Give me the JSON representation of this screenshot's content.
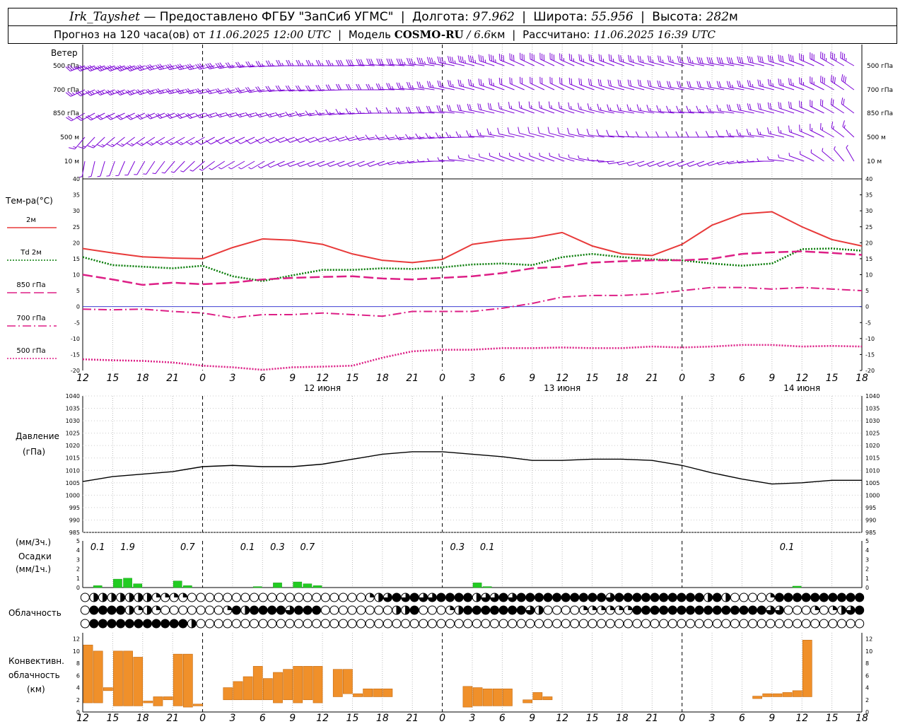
{
  "header": {
    "station": "Irk_Tayshet",
    "dash": "—",
    "provider": "Предоставлено ФГБУ \"ЗапСиб УГМС\"",
    "lon_label": "Долгота:",
    "lon_value": "97.962",
    "lat_label": "Широта:",
    "lat_value": "55.956",
    "alt_label": "Высота:",
    "alt_value": "282",
    "alt_unit": "м",
    "forecast_prefix": "Прогноз на 120 часа(ов) от",
    "forecast_time": "11.06.2025 12:00 UTC",
    "model_label": "Модель",
    "model_name": "COSMO-RU",
    "model_res": "/ 6.6",
    "model_res_unit": "км",
    "computed_label": "Рассчитано:",
    "computed_time": "11.06.2025 16:39 UTC"
  },
  "labels": {
    "wind": "Ветер",
    "wind_levels": [
      "500 гПа",
      "700 гПа",
      "850 гПа",
      "500 м",
      "10  м"
    ],
    "temp_title": "Тем-ра(°С)",
    "pressure_title_1": "Давление",
    "pressure_title_2": "(гПа)",
    "precip_title_1": "(мм/3ч.)",
    "precip_title_2": "Осадки",
    "precip_title_3": "(мм/1ч.)",
    "cloud_title": "Облачность",
    "conv_title_1": "Конвективн.",
    "conv_title_2": "облачность",
    "conv_title_3": "(км)"
  },
  "colors": {
    "wind": "#7a00d6",
    "t2m": "#e83a3a",
    "td2m": "#0a7d0a",
    "t850": "#dd1f86",
    "t700": "#dd1f86",
    "t500": "#dd1f86",
    "pressure": "#000000",
    "precip": "#22cc22",
    "conv": "#f0902a",
    "zero_line": "#2222cc"
  },
  "x_axis": {
    "tick_labels": [
      "12",
      "15",
      "18",
      "21",
      "0",
      "3",
      "6",
      "9",
      "12",
      "15",
      "18",
      "21",
      "0",
      "3",
      "6",
      "9",
      "12",
      "15",
      "18",
      "21",
      "0",
      "3",
      "6",
      "9",
      "12",
      "15",
      "18"
    ],
    "day_labels": [
      {
        "index": 8,
        "text": "12 июня"
      },
      {
        "index": 16,
        "text": "13 июня"
      },
      {
        "index": 24,
        "text": "14 июня"
      }
    ]
  },
  "chart_data": [
    {
      "type": "line",
      "name": "temperature",
      "x_hours": [
        0,
        3,
        6,
        9,
        12,
        15,
        18,
        21,
        24,
        27,
        30,
        33,
        36,
        39,
        42,
        45,
        48,
        51,
        54,
        57,
        60,
        63,
        66,
        69,
        72,
        75,
        78
      ],
      "ylim": [
        -20,
        40
      ],
      "yticks": [
        -20,
        -15,
        -10,
        -5,
        0,
        5,
        10,
        15,
        20,
        25,
        30,
        35,
        40
      ],
      "series": [
        {
          "name": "2м",
          "key": "t2m",
          "style": "solid",
          "values": [
            18.2,
            16.8,
            15.6,
            15.2,
            15.0,
            18.5,
            21.2,
            20.8,
            19.5,
            16.5,
            14.5,
            13.8,
            14.8,
            19.5,
            20.8,
            21.5,
            23.2,
            19.0,
            16.5,
            16.0,
            19.5,
            25.5,
            29.0,
            29.7,
            25.0,
            21.0,
            19.0
          ]
        },
        {
          "name": "Td  2м",
          "key": "td2m",
          "style": "dotted",
          "values": [
            15.5,
            13.0,
            12.5,
            12.0,
            12.8,
            9.5,
            8.0,
            9.8,
            11.5,
            11.5,
            12.0,
            11.8,
            12.3,
            13.2,
            13.5,
            13.0,
            15.5,
            16.5,
            15.5,
            14.8,
            14.5,
            13.5,
            12.8,
            13.5,
            18.0,
            18.2,
            17.5
          ]
        },
        {
          "name": "850 гПа",
          "key": "t850",
          "style": "dash",
          "values": [
            10.0,
            8.5,
            6.8,
            7.5,
            7.0,
            7.5,
            8.5,
            9.0,
            9.3,
            9.5,
            8.8,
            8.5,
            9.0,
            9.5,
            10.5,
            12.0,
            12.5,
            13.8,
            14.2,
            14.5,
            14.5,
            15.0,
            16.5,
            17.0,
            17.3,
            16.8,
            16.2
          ]
        },
        {
          "name": "700 гПа",
          "key": "t700",
          "style": "dashdot",
          "values": [
            -0.8,
            -1.0,
            -0.8,
            -1.5,
            -2.0,
            -3.5,
            -2.5,
            -2.5,
            -2.0,
            -2.5,
            -3.0,
            -1.5,
            -1.5,
            -1.5,
            -0.5,
            1.0,
            3.0,
            3.5,
            3.5,
            4.0,
            5.0,
            6.0,
            6.0,
            5.5,
            6.0,
            5.5,
            5.0
          ]
        },
        {
          "name": "500 гПа",
          "key": "t500",
          "style": "dotted",
          "values": [
            -16.5,
            -16.8,
            -17.0,
            -17.5,
            -18.5,
            -19.0,
            -19.8,
            -19.0,
            -18.8,
            -18.5,
            -16.0,
            -14.0,
            -13.5,
            -13.5,
            -13.0,
            -13.0,
            -12.8,
            -13.0,
            -13.0,
            -12.5,
            -12.8,
            -12.5,
            -12.0,
            -12.0,
            -12.5,
            -12.3,
            -12.5
          ]
        }
      ]
    },
    {
      "type": "line",
      "name": "pressure",
      "x_hours": [
        0,
        3,
        6,
        9,
        12,
        15,
        18,
        21,
        24,
        27,
        30,
        33,
        36,
        39,
        42,
        45,
        48,
        51,
        54,
        57,
        60,
        63,
        66,
        69,
        72,
        75,
        78
      ],
      "ylim": [
        985,
        1040
      ],
      "yticks": [
        985,
        990,
        995,
        1000,
        1005,
        1010,
        1015,
        1020,
        1025,
        1030,
        1035,
        1040
      ],
      "series": [
        {
          "name": "Давление",
          "key": "pressure",
          "values": [
            1005.5,
            1007.5,
            1008.5,
            1009.5,
            1011.5,
            1012.0,
            1011.5,
            1011.5,
            1012.5,
            1014.5,
            1016.5,
            1017.5,
            1017.5,
            1016.5,
            1015.5,
            1014.0,
            1014.0,
            1014.5,
            1014.5,
            1014.0,
            1012.0,
            1009.0,
            1006.5,
            1004.5,
            1005.0,
            1006.0,
            1006.0
          ]
        }
      ]
    },
    {
      "type": "bar",
      "name": "precipitation",
      "ylim": [
        0,
        5
      ],
      "yticks": [
        0,
        1,
        2,
        3,
        4,
        5
      ],
      "hourly_bars": [
        {
          "h": 1,
          "v": 0.2
        },
        {
          "h": 3,
          "v": 0.9
        },
        {
          "h": 4,
          "v": 1.0
        },
        {
          "h": 5,
          "v": 0.4
        },
        {
          "h": 9,
          "v": 0.7
        },
        {
          "h": 10,
          "v": 0.2
        },
        {
          "h": 17,
          "v": 0.1
        },
        {
          "h": 19,
          "v": 0.5
        },
        {
          "h": 21,
          "v": 0.6
        },
        {
          "h": 22,
          "v": 0.4
        },
        {
          "h": 23,
          "v": 0.2
        },
        {
          "h": 39,
          "v": 0.5
        },
        {
          "h": 40,
          "v": 0.1
        },
        {
          "h": 71,
          "v": 0.15
        }
      ],
      "three_hour_labels": [
        {
          "h": 1.5,
          "text": "0.1"
        },
        {
          "h": 4.5,
          "text": "1.9"
        },
        {
          "h": 10.5,
          "text": "0.7"
        },
        {
          "h": 16.5,
          "text": "0.1"
        },
        {
          "h": 19.5,
          "text": "0.3"
        },
        {
          "h": 22.5,
          "text": "0.7"
        },
        {
          "h": 37.5,
          "text": "0.3"
        },
        {
          "h": 40.5,
          "text": "0.1"
        },
        {
          "h": 70.5,
          "text": "0.1"
        }
      ]
    },
    {
      "type": "bar",
      "name": "convective_cloud",
      "ylim": [
        0,
        13
      ],
      "yticks": [
        0,
        2,
        4,
        6,
        8,
        10,
        12
      ],
      "bars": [
        {
          "h": 0,
          "base": 1.5,
          "top": 11.0
        },
        {
          "h": 1,
          "base": 1.5,
          "top": 10.0
        },
        {
          "h": 2,
          "base": 3.5,
          "top": 4.0
        },
        {
          "h": 3,
          "base": 1.0,
          "top": 10.0
        },
        {
          "h": 4,
          "base": 1.0,
          "top": 10.0
        },
        {
          "h": 5,
          "base": 1.0,
          "top": 9.0
        },
        {
          "h": 6,
          "base": 1.5,
          "top": 1.8
        },
        {
          "h": 7,
          "base": 1.0,
          "top": 2.5
        },
        {
          "h": 8,
          "base": 2.0,
          "top": 2.5
        },
        {
          "h": 9,
          "base": 1.0,
          "top": 9.5
        },
        {
          "h": 10,
          "base": 0.8,
          "top": 9.5
        },
        {
          "h": 11,
          "base": 1.0,
          "top": 1.3
        },
        {
          "h": 14,
          "base": 2.0,
          "top": 4.0
        },
        {
          "h": 15,
          "base": 2.0,
          "top": 5.0
        },
        {
          "h": 16,
          "base": 2.0,
          "top": 5.8
        },
        {
          "h": 17,
          "base": 2.0,
          "top": 7.5
        },
        {
          "h": 18,
          "base": 2.0,
          "top": 5.5
        },
        {
          "h": 19,
          "base": 1.5,
          "top": 6.5
        },
        {
          "h": 20,
          "base": 2.0,
          "top": 7.0
        },
        {
          "h": 21,
          "base": 1.5,
          "top": 7.5
        },
        {
          "h": 22,
          "base": 2.0,
          "top": 7.5
        },
        {
          "h": 23,
          "base": 1.5,
          "top": 7.5
        },
        {
          "h": 25,
          "base": 2.5,
          "top": 7.0
        },
        {
          "h": 26,
          "base": 3.0,
          "top": 7.0
        },
        {
          "h": 27,
          "base": 2.5,
          "top": 3.0
        },
        {
          "h": 28,
          "base": 2.5,
          "top": 3.8
        },
        {
          "h": 29,
          "base": 2.5,
          "top": 3.8
        },
        {
          "h": 30,
          "base": 2.5,
          "top": 3.8
        },
        {
          "h": 38,
          "base": 0.8,
          "top": 4.2
        },
        {
          "h": 39,
          "base": 1.0,
          "top": 4.0
        },
        {
          "h": 40,
          "base": 1.0,
          "top": 3.8
        },
        {
          "h": 41,
          "base": 1.0,
          "top": 3.8
        },
        {
          "h": 42,
          "base": 1.0,
          "top": 3.8
        },
        {
          "h": 44,
          "base": 1.5,
          "top": 2.0
        },
        {
          "h": 45,
          "base": 2.0,
          "top": 3.2
        },
        {
          "h": 46,
          "base": 2.0,
          "top": 2.5
        },
        {
          "h": 67,
          "base": 2.2,
          "top": 2.6
        },
        {
          "h": 68,
          "base": 2.5,
          "top": 3.0
        },
        {
          "h": 69,
          "base": 2.5,
          "top": 3.0
        },
        {
          "h": 70,
          "base": 2.5,
          "top": 3.2
        },
        {
          "h": 71,
          "base": 2.5,
          "top": 3.5
        },
        {
          "h": 72,
          "base": 2.5,
          "top": 11.8
        }
      ]
    },
    {
      "type": "table",
      "name": "cloud_cover",
      "legend": "0=clear, 1=quarter, 2=half, 3=three quarters, 4=overcast",
      "rows": [
        {
          "level": "upper",
          "values": "0222222211110000000000000000000012343433444423343444444444434444444444242000014444444444"
        },
        {
          "level": "middle",
          "values": "0444421210000000142444434440000000022400012444444432000011111144444444444444433000101234"
        },
        {
          "level": "lower",
          "values": "0444444444442000000000000000000000000000000000000000000000000000000000000000000000000000"
        }
      ]
    },
    {
      "type": "scatter",
      "name": "wind_barbs",
      "levels": [
        "500 гПа",
        "700 гПа",
        "850 гПа",
        "500 м",
        "10  м"
      ],
      "x_hours": [
        0,
        3,
        6,
        9,
        12,
        15,
        18,
        21,
        24,
        27,
        30,
        33,
        36,
        39,
        42,
        45,
        48,
        51,
        54,
        57,
        60,
        63,
        66,
        69,
        72,
        75,
        78
      ],
      "direction_deg": [
        [
          250,
          250,
          250,
          255,
          255,
          260,
          265,
          270,
          270,
          270,
          275,
          275,
          280,
          285,
          290,
          295,
          295,
          290,
          290,
          285,
          285,
          280,
          280,
          285,
          290,
          300,
          300
        ],
        [
          245,
          250,
          250,
          255,
          255,
          255,
          260,
          265,
          265,
          270,
          270,
          275,
          280,
          285,
          290,
          295,
          295,
          290,
          285,
          285,
          280,
          280,
          280,
          285,
          290,
          300,
          310
        ],
        [
          240,
          245,
          245,
          250,
          250,
          255,
          255,
          255,
          260,
          265,
          270,
          270,
          275,
          280,
          285,
          290,
          290,
          285,
          280,
          280,
          275,
          275,
          280,
          285,
          290,
          300,
          310
        ],
        [
          220,
          230,
          235,
          240,
          240,
          245,
          245,
          250,
          250,
          255,
          260,
          260,
          265,
          270,
          280,
          285,
          285,
          280,
          275,
          270,
          270,
          270,
          275,
          280,
          290,
          300,
          320
        ],
        [
          190,
          200,
          210,
          220,
          230,
          240,
          240,
          250,
          250,
          250,
          250,
          260,
          270,
          280,
          290,
          290,
          290,
          280,
          260,
          250,
          250,
          250,
          260,
          270,
          290,
          310,
          340
        ]
      ],
      "speed_kt": [
        [
          35,
          35,
          35,
          30,
          30,
          30,
          25,
          25,
          25,
          30,
          30,
          35,
          35,
          35,
          35,
          30,
          30,
          25,
          25,
          25,
          25,
          30,
          30,
          30,
          30,
          35,
          40
        ],
        [
          25,
          25,
          25,
          25,
          25,
          20,
          20,
          20,
          20,
          20,
          25,
          25,
          25,
          25,
          25,
          20,
          20,
          20,
          20,
          20,
          20,
          20,
          25,
          25,
          25,
          30,
          30
        ],
        [
          20,
          20,
          20,
          20,
          20,
          15,
          15,
          15,
          15,
          15,
          15,
          20,
          20,
          20,
          20,
          15,
          15,
          15,
          15,
          15,
          15,
          15,
          20,
          20,
          20,
          20,
          20
        ],
        [
          15,
          15,
          15,
          15,
          15,
          10,
          10,
          10,
          10,
          10,
          10,
          15,
          15,
          15,
          15,
          10,
          10,
          10,
          10,
          10,
          10,
          10,
          15,
          15,
          15,
          15,
          15
        ],
        [
          5,
          5,
          5,
          5,
          5,
          5,
          5,
          5,
          5,
          5,
          5,
          5,
          5,
          5,
          5,
          5,
          5,
          5,
          5,
          5,
          5,
          5,
          5,
          5,
          5,
          5,
          5
        ]
      ]
    }
  ]
}
